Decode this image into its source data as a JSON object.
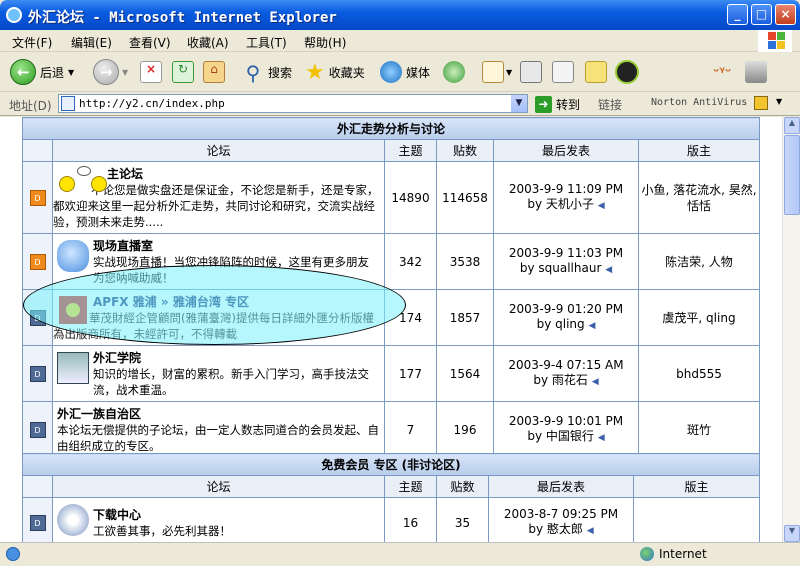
{
  "window": {
    "title": "外汇论坛 - Microsoft Internet Explorer",
    "min": "_",
    "max": "□",
    "close": "×"
  },
  "menu": [
    "文件(F)",
    "编辑(E)",
    "查看(V)",
    "收藏(A)",
    "工具(T)",
    "帮助(H)"
  ],
  "toolbar": {
    "back": "后退",
    "search": "搜索",
    "favorites": "收藏夹",
    "media": "媒体"
  },
  "address": {
    "label": "地址(D)",
    "url": "http://y2.cn/index.php",
    "go": "转到",
    "links": "链接",
    "norton": "Norton AntiVirus"
  },
  "section1": {
    "title": "外汇走势分析与讨论",
    "columns": {
      "forum": "论坛",
      "topics": "主题",
      "posts": "贴数",
      "last": "最后发表",
      "mod": "版主"
    },
    "rows": [
      {
        "name": "主论坛",
        "desc": "不论您是做实盘还是保证金，不论您是新手，还是专家，都欢迎来这里一起分析外汇走势，共同讨论和研究，交流实战经验，预测未来走势.....",
        "topics": "14890",
        "posts": "114658",
        "last_time": "2003-9-9 11:09 PM",
        "last_by": "by 天机小子",
        "mod": "小鱼, 落花流水, 昊然, 恬恬"
      },
      {
        "name": "现场直播室",
        "desc": "实战现场直播！当您冲锋陷阵的时候，这里有更多朋友为您呐喊助威！",
        "topics": "342",
        "posts": "3538",
        "last_time": "2003-9-9 11:03 PM",
        "last_by": "by squallhaur",
        "mod": "陈洁荣, 人物"
      },
      {
        "name": "APFX 雅浦 » 雅浦台湾 专区",
        "desc": "華茂財經企管顧問(雅蒲臺灣)提供每日詳細外匯分析版權為出版商所有，未經許可，不得轉載",
        "topics": "174",
        "posts": "1857",
        "last_time": "2003-9-9 01:20 PM",
        "last_by": "by qling",
        "mod": "虞茂平, qling"
      },
      {
        "name": "外汇学院",
        "desc": "知识的增长，财富的累积。新手入门学习，高手技法交流，战术重温。",
        "topics": "177",
        "posts": "1564",
        "last_time": "2003-9-4 07:15 AM",
        "last_by": "by 雨花石",
        "mod": "bhd555"
      },
      {
        "name": "外汇一族自治区",
        "desc": "本论坛无偿提供的子论坛，由一定人数志同道合的会员发起、自由组织成立的专区。",
        "topics": "7",
        "posts": "196",
        "last_time": "2003-9-9 10:01 PM",
        "last_by": "by 中国银行",
        "mod": "斑竹"
      }
    ]
  },
  "section2": {
    "title": "免费会员 专区 (非讨论区)",
    "columns": {
      "forum": "论坛",
      "topics": "主题",
      "posts": "贴数",
      "last": "最后发表",
      "mod": "版主"
    },
    "rows": [
      {
        "name": "下载中心",
        "desc": "工欲善其事，必先利其器！",
        "topics": "16",
        "posts": "35",
        "last_time": "2003-8-7 09:25 PM",
        "last_by": "by 憨太郎",
        "mod": ""
      }
    ]
  },
  "status": {
    "zone": "Internet"
  }
}
